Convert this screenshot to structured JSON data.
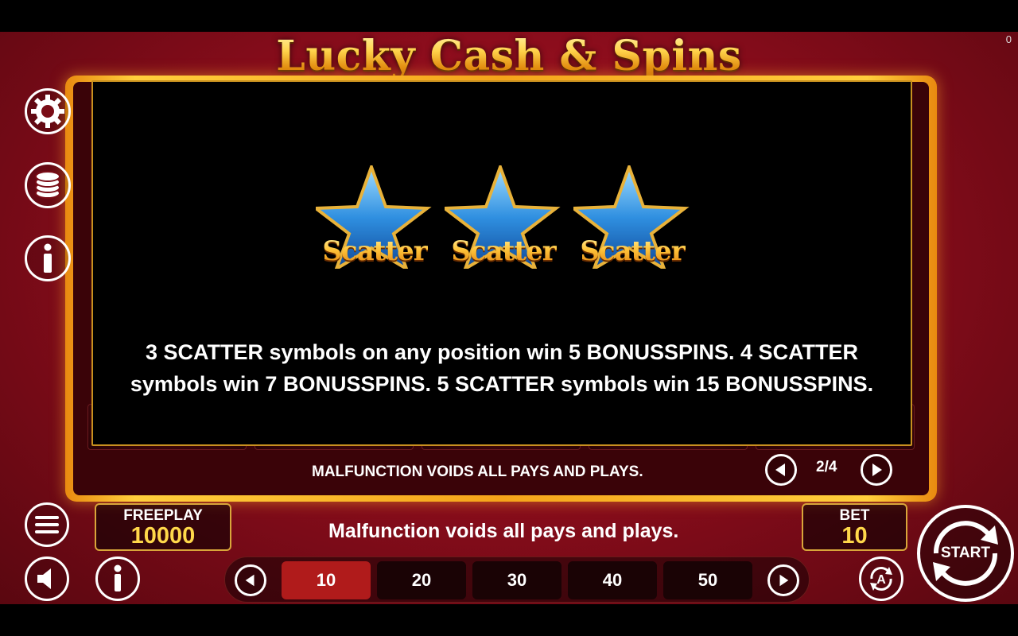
{
  "game": {
    "title": "Lucky Cash & Spins",
    "corner_counter": "0"
  },
  "paytable": {
    "scatter_symbols": [
      {
        "label": "Scatter"
      },
      {
        "label": "Scatter"
      },
      {
        "label": "Scatter"
      }
    ],
    "rules_text": "3 SCATTER symbols on any position win 5 BONUSSPINS. 4 SCATTER symbols win 7 BONUSSPINS. 5 SCATTER symbols win 15 BONUSSPINS.",
    "disclaimer": "MALFUNCTION VOIDS ALL PAYS AND PLAYS.",
    "page_indicator": "2/4"
  },
  "hud": {
    "balance_label": "FREEPLAY",
    "balance_value": "10000",
    "message": "Malfunction voids all pays and plays.",
    "bet_label": "BET",
    "bet_value": "10",
    "bet_options": [
      "10",
      "20",
      "30",
      "40",
      "50"
    ],
    "selected_bet_index": 0,
    "start_label": "START"
  },
  "icons": {
    "settings": "gear-icon",
    "coins": "coin-stack-icon",
    "info_side": "info-icon",
    "menu": "menu-icon",
    "sound": "speaker-icon",
    "info_bottom": "info-icon",
    "autoplay": "autoplay-icon",
    "prev": "arrow-left-icon",
    "next": "arrow-right-icon"
  },
  "colors": {
    "background_red": "#8c0d1c",
    "gold": "#ffd84a",
    "frame_orange": "#f5a41a",
    "selected_bet": "#b01b1b",
    "star_blue": "#2f8fe0"
  }
}
